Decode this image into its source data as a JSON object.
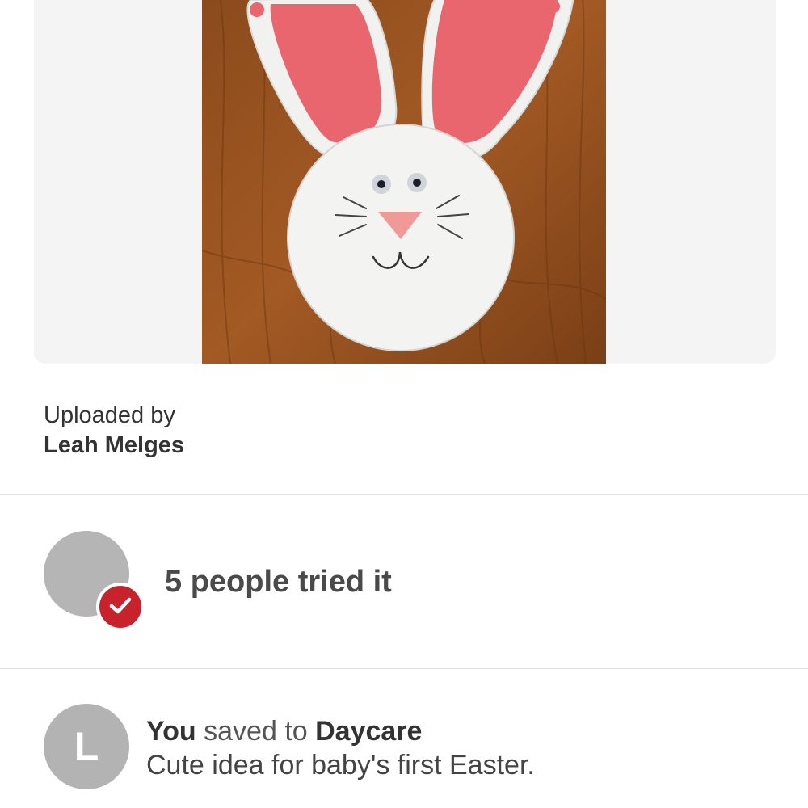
{
  "pin": {
    "image_icon": "easter-bunny-footprint-craft-image"
  },
  "uploader": {
    "label": "Uploaded by",
    "name": "Leah Melges"
  },
  "tried": {
    "text": "5 people tried it",
    "check_icon": "check-icon",
    "badge_color": "#c8232c"
  },
  "saved": {
    "avatar_letter": "L",
    "actor": "You",
    "verb": " saved to ",
    "board": "Daycare",
    "note": "Cute idea for baby's first Easter."
  }
}
